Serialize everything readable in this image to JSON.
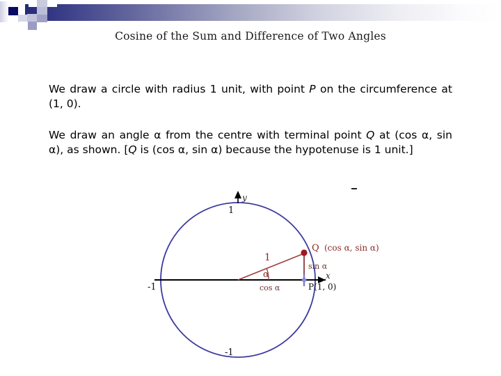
{
  "slide": {
    "title": "Cosine of the Sum and Difference of Two Angles",
    "paragraph_1_part_1": "We draw a circle with radius 1 unit, with point ",
    "paragraph_1_italic": "P",
    "paragraph_1_part_2": " on the circumference at (1, 0).",
    "paragraph_2_part_1": "We draw an angle α from the centre with terminal point ",
    "paragraph_2_italic_1": "Q",
    "paragraph_2_part_2": " at (cos α, sin α), as shown. [",
    "paragraph_2_italic_2": "Q",
    "paragraph_2_part_3": " is (cos α, sin α) because the hypotenuse is 1 unit.]"
  },
  "colors": {
    "header_gradient_start": "#262a7a",
    "header_gradient_end": "#ffffff",
    "header_square_dark": "#090a63",
    "circle_stroke": "#3b3b9e",
    "triangle_stroke": "#a03c3c",
    "point_q_fill": "#a01820",
    "point_p_fill": "#7a7ad0",
    "axis_stroke": "#000000",
    "label_red": "#8b2b2b",
    "title_text": "#1a1a1a"
  },
  "diagram": {
    "name": "unit-circle-with-angle-alpha",
    "axis_x_label": "x",
    "axis_y_label": "y",
    "tick_y_top": "1",
    "tick_y_bottom": "-1",
    "tick_x_left": "-1",
    "label_point_q": "Q",
    "label_point_q_coords": "(cos α, sin α)",
    "label_point_p": "P(1, 0)",
    "label_hypotenuse": "1",
    "label_angle": "α",
    "label_adjacent": "cos α",
    "label_opposite": "sin α",
    "stray_mark": "-"
  },
  "chart_data": {
    "type": "scatter",
    "title": "Unit circle with angle alpha",
    "xlabel": "x",
    "ylabel": "y",
    "xlim": [
      -1.35,
      1.35
    ],
    "ylim": [
      -1.25,
      1.25
    ],
    "grid": false,
    "legend": "none",
    "circle": {
      "center": [
        0,
        0
      ],
      "radius": 1,
      "color": "#3b3b9e"
    },
    "points": [
      {
        "name": "Q",
        "x": 0.92,
        "y": 0.38,
        "label": "Q  (cos α, sin α)",
        "color": "#a01820"
      },
      {
        "name": "P",
        "x": 1.0,
        "y": 0.0,
        "label": "P(1, 0)",
        "color": "#7a7ad0"
      },
      {
        "name": "O",
        "x": 0.0,
        "y": 0.0,
        "label": "",
        "color": "#000000"
      }
    ],
    "segments": [
      {
        "name": "hypotenuse",
        "from": [
          0,
          0
        ],
        "to": [
          0.92,
          0.38
        ],
        "label": "1",
        "color": "#a03c3c"
      },
      {
        "name": "adjacent",
        "from": [
          0,
          0
        ],
        "to": [
          0.92,
          0
        ],
        "label": "cos α",
        "color": "#000000"
      },
      {
        "name": "opposite",
        "from": [
          0.92,
          0
        ],
        "to": [
          0.92,
          0.38
        ],
        "label": "sin α",
        "color": "#a03c3c"
      }
    ],
    "angle": {
      "name": "alpha",
      "vertex": [
        0,
        0
      ],
      "label": "α",
      "degrees": 22
    },
    "tick_labels": {
      "y_top": "1",
      "y_bottom": "-1",
      "x_left": "-1"
    }
  }
}
